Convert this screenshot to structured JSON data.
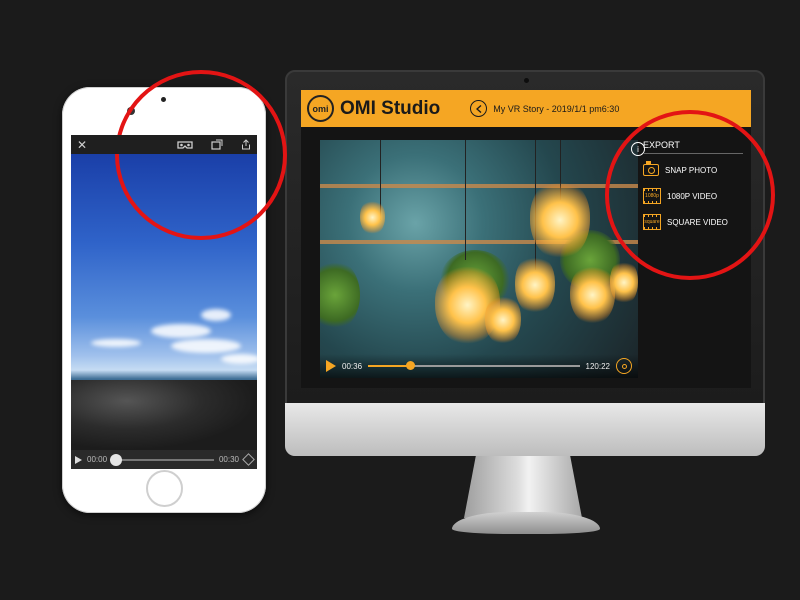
{
  "colors": {
    "accent": "#f5a623",
    "highlight": "#e31414"
  },
  "phone": {
    "close_icon": "✕",
    "vr_icon": "vr-goggles",
    "rotate_icon": "rotate-screen",
    "share_icon": "share",
    "time_current": "00:00",
    "time_total": "00:30",
    "progress": 0.0
  },
  "studio": {
    "app_title": "OMI Studio",
    "logo_text": "omi",
    "story_title": "My VR Story - 2019/1/1 pm6:30",
    "info_label": "i",
    "video": {
      "time_current": "00:36",
      "time_total": "120:22",
      "progress": 0.2
    },
    "export": {
      "title": "EXPORT",
      "items": [
        {
          "label": "SNAP PHOTO",
          "icon": "camera-icon"
        },
        {
          "label": "1080P VIDEO",
          "icon": "film-1080p-icon",
          "icon_text": "1080p"
        },
        {
          "label": "SQUARE VIDEO",
          "icon": "film-square-icon",
          "icon_text": "square"
        }
      ]
    }
  }
}
